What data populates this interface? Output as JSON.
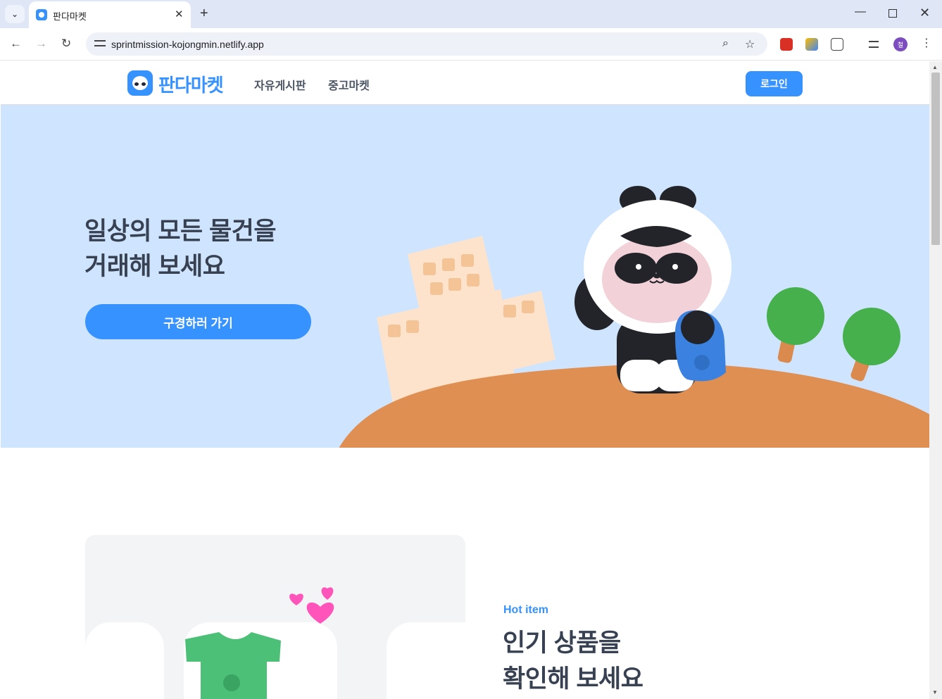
{
  "browser": {
    "tab_title": "판다마켓",
    "url": "sprintmission-kojongmin.netlify.app",
    "avatar_initial": "철"
  },
  "header": {
    "logo_text": "판다마켓",
    "nav": [
      "자유게시판",
      "중고마켓"
    ],
    "login_label": "로그인"
  },
  "hero": {
    "title_line1": "일상의 모든 물건을",
    "title_line2": "거래해 보세요",
    "cta_label": "구경하러 가기"
  },
  "feature": {
    "label": "Hot item",
    "title_line1": "인기 상품을",
    "title_line2": "확인해 보세요"
  },
  "colors": {
    "brand": "#3692ff",
    "hero_bg": "#cfe5ff",
    "heading": "#374151"
  }
}
